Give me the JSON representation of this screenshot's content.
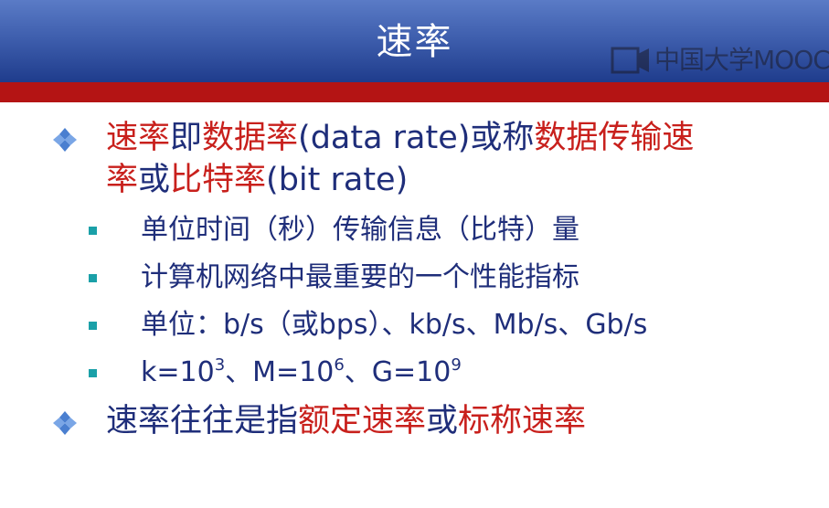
{
  "slide": {
    "title": "速率",
    "watermark": "中国大学MOOC",
    "bullets": [
      {
        "line1": [
          {
            "text": "速率",
            "color": "red"
          },
          {
            "text": "即",
            "color": "blue"
          },
          {
            "text": "数据率",
            "color": "red"
          },
          {
            "text": "(data rate)或称",
            "color": "blue"
          },
          {
            "text": "数据传输速",
            "color": "red"
          }
        ],
        "line2": [
          {
            "text": "率",
            "color": "red"
          },
          {
            "text": "或",
            "color": "blue"
          },
          {
            "text": "比特率",
            "color": "red"
          },
          {
            "text": "(bit rate)",
            "color": "blue"
          }
        ]
      },
      {
        "line1": [
          {
            "text": "速率往往是指",
            "color": "blue"
          },
          {
            "text": "额定速率",
            "color": "red"
          },
          {
            "text": "或",
            "color": "blue"
          },
          {
            "text": "标称速率",
            "color": "red"
          }
        ]
      }
    ],
    "sub_bullets": [
      "单位时间（秒）传输信息（比特）量",
      "计算机网络中最重要的一个性能指标",
      "单位：b/s（或bps）、kb/s、Mb/s、Gb/s"
    ],
    "formula": {
      "k_prefix": "k=10",
      "k_exp": "3",
      "m_prefix": "、M=10",
      "m_exp": "6",
      "g_prefix": "、G=10",
      "g_exp": "9"
    },
    "colors": {
      "title_bar": "#3f5fae",
      "red_band": "#b41414",
      "text_blue": "#1f2e7a",
      "text_red": "#c8201c",
      "sub_bullet": "#1aa0a8",
      "diamond": "#4a7fd0"
    },
    "icons": {
      "main_bullet": "four-diamond-icon",
      "sub_bullet": "square-bullet-icon",
      "watermark_logo": "mooc-logo-icon"
    }
  }
}
